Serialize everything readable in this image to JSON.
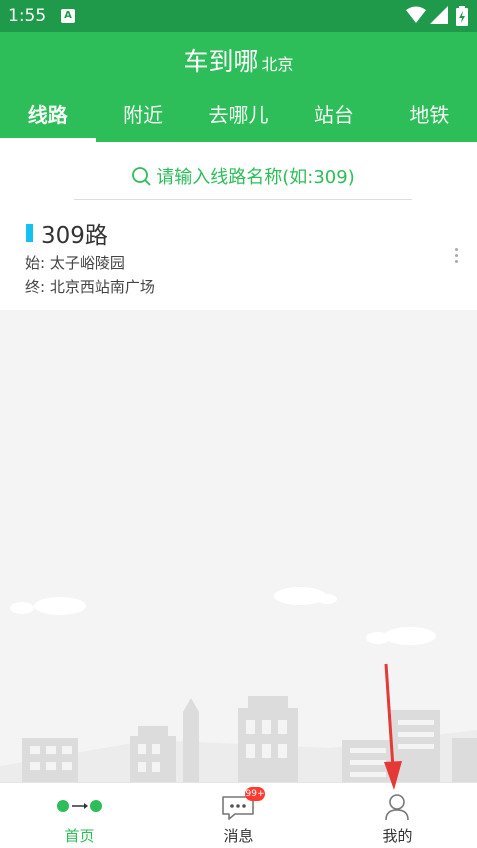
{
  "status_bar": {
    "time": "1:55",
    "notification_icon_letter": "A"
  },
  "header": {
    "title": "车到哪",
    "city": "北京"
  },
  "tabs": [
    {
      "label": "线路",
      "active": true
    },
    {
      "label": "附近",
      "active": false
    },
    {
      "label": "去哪儿",
      "active": false
    },
    {
      "label": "站台",
      "active": false
    },
    {
      "label": "地铁",
      "active": false
    }
  ],
  "search": {
    "placeholder": "请输入线路名称(如:309)"
  },
  "route": {
    "name": "309路",
    "start": "始: 太子峪陵园",
    "end": "终: 北京西站南广场"
  },
  "bottom_nav": [
    {
      "label": "首页",
      "icon": "route-dots-icon",
      "active": true
    },
    {
      "label": "消息",
      "icon": "message-icon",
      "active": false,
      "badge": "99+"
    },
    {
      "label": "我的",
      "icon": "profile-icon",
      "active": false
    }
  ],
  "colors": {
    "primary": "#2dbe59",
    "status_bar": "#1f9a4a",
    "route_marker": "#12c2ef",
    "badge": "#ff3b30",
    "annotation_arrow": "#e53935"
  }
}
